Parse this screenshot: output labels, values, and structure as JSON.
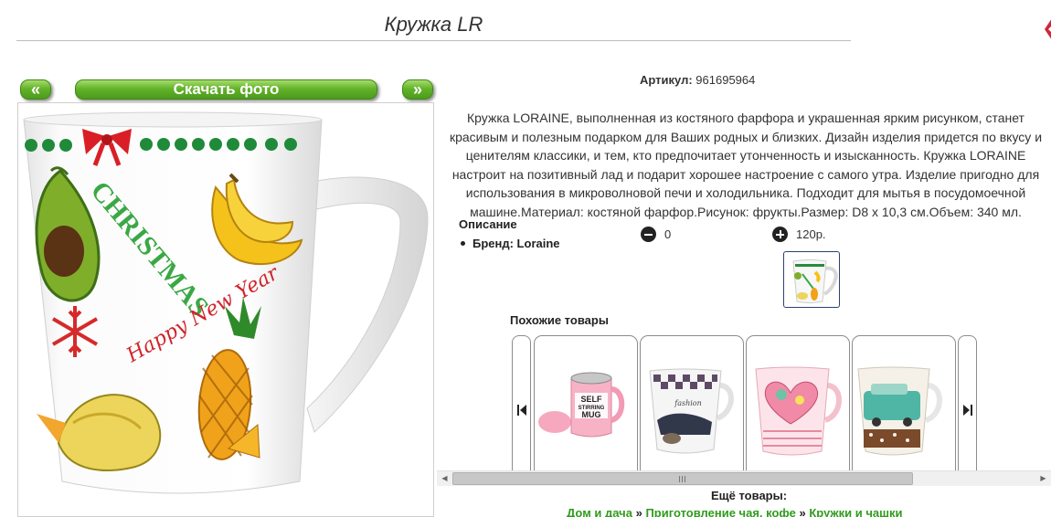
{
  "product": {
    "title": "Кружка LR",
    "article_label": "Артикул:",
    "article_value": "961695964",
    "description": "Кружка LORAINE, выполненная из костяного фарфора и украшенная ярким рисунком, станет красивым и полезным подарком для Ваших родных и близких. Дизайн изделия придется по вкусу и ценителям классики, и тем, кто предпочитает утонченность и изысканность. Кружка LORAINE настроит на позитивный лад и подарит хорошее настроение с самого утра. Изделие пригодно для использования в микроволновой печи и холодильника. Подходит для мытья в посудомоечной машине.Материал: костяной фарфор.Рисунок: фрукты.Размер: D8 x 10,3 см.Объем: 340 мл.",
    "description_heading": "Описание",
    "brand": "Бренд: Loraine",
    "quantity": "0",
    "price": "120р."
  },
  "gallery": {
    "prev_label": "«",
    "next_label": "»",
    "download_label": "Скачать фото",
    "mug_text_christmas": "CHRISTMAS",
    "mug_text_happy": "Happy New Year"
  },
  "similar": {
    "heading": "Похожие товары",
    "mug1_text": [
      "SELF",
      "STIRRING",
      "MUG"
    ],
    "mug2_text": "fashion"
  },
  "more": {
    "heading": "Ещё товары:",
    "crumbs": [
      "Дом и дача",
      "Приготовление чая, кофе",
      "Кружки и чашки"
    ],
    "separator": "»"
  },
  "colors": {
    "button_green": "#62b32a",
    "link_green": "#2f9c1c",
    "thumb_border": "#2d3f73"
  },
  "icons": [
    "minus-circle-icon",
    "plus-circle-icon",
    "skip-previous-icon",
    "skip-next-icon",
    "scroll-left-icon",
    "scroll-right-icon"
  ]
}
